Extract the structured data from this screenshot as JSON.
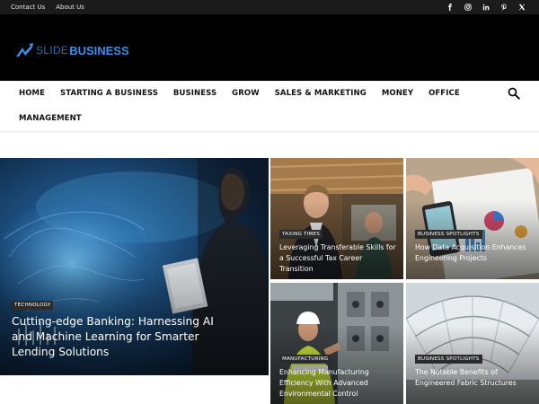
{
  "topbar": {
    "links": [
      "Contact Us",
      "About Us"
    ],
    "social_icons": [
      "facebook-icon",
      "instagram-icon",
      "linkedin-icon",
      "pinterest-icon",
      "x-icon"
    ]
  },
  "logo": {
    "part1": "SLIDE",
    "part2": "BUSINESS"
  },
  "nav": {
    "row1": [
      "HOME",
      "STARTING A BUSINESS",
      "BUSINESS",
      "GROW",
      "SALES & MARKETING",
      "MONEY",
      "OFFICE"
    ],
    "row2": [
      "MANAGEMENT"
    ],
    "search_icon": "search-icon"
  },
  "featured": {
    "main": {
      "category": "TECHNOLOGY",
      "title": "Cutting-edge Banking: Harnessing AI and Machine Learning for Smarter Lending Solutions"
    },
    "tiles": [
      {
        "category": "TAXING TIMES",
        "title": "Leveraging Transferable Skills for a Successful Tax Career Transition"
      },
      {
        "category": "BUSINESS SPOTLIGHTS",
        "title": "How Data Acquisition Enhances Engineering Projects"
      },
      {
        "category": "MANUFACTURING",
        "title": "Enhancing Manufacturing Efficiency With Advanced Environmental Control"
      },
      {
        "category": "BUSINESS SPOTLIGHTS",
        "title": "The Notable Benefits of Engineered Fabric Structures"
      }
    ]
  },
  "colors": {
    "topbar_bg": "#1b1b1b",
    "header_bg": "#000000",
    "logo_blue": "#3b8fe8",
    "badge_bg": "#2b2b2b"
  }
}
